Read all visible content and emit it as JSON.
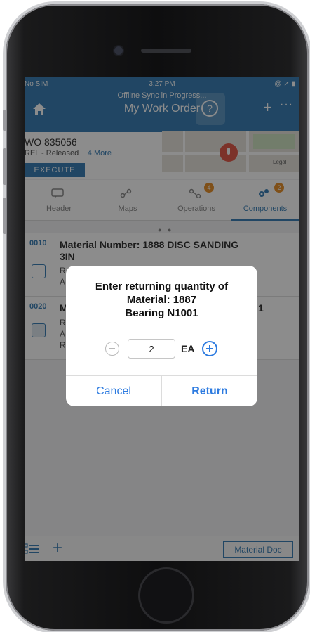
{
  "colors": {
    "brand": "#3c80b6",
    "dialog_accent": "#2d7be0",
    "badge": "#e8922e"
  },
  "status_bar": {
    "carrier": "No SIM",
    "time": "3:27 PM",
    "right_icons": "@ ➚ ▮"
  },
  "nav": {
    "sync_text": "Offline Sync in Progress...",
    "title": "My Work Order",
    "home_icon": "home-icon",
    "add_label": "+",
    "more_label": "···"
  },
  "work_order": {
    "number": "WO 835056",
    "status": "REL - Released",
    "more_link": "+ 4 More",
    "execute_label": "EXECUTE",
    "map_legal": "Legal"
  },
  "tabs": [
    {
      "label": "Header",
      "icon": "chat-icon",
      "badge": ""
    },
    {
      "label": "Maps",
      "icon": "map-icon",
      "badge": ""
    },
    {
      "label": "Operations",
      "icon": "operations-icon",
      "badge": "4"
    },
    {
      "label": "Components",
      "icon": "gears-icon",
      "badge": "2"
    }
  ],
  "pager_dots": "● ●",
  "items": [
    {
      "code": "0010",
      "material": "Material Number: 1888 DISC SANDING 3IN",
      "line1": "R",
      "line2": "A"
    },
    {
      "code": "0020",
      "material": "M",
      "material_tail": "1",
      "line1": "R",
      "line2": "A",
      "line3": "R"
    }
  ],
  "bottom_bar": {
    "add_label": "+",
    "material_doc_label": "Material Doc"
  },
  "dialog": {
    "line1": "Enter returning quantity of",
    "line2": "Material: 1887",
    "line3": "Bearing N1001",
    "quantity": "2",
    "unit": "EA",
    "cancel_label": "Cancel",
    "return_label": "Return"
  }
}
